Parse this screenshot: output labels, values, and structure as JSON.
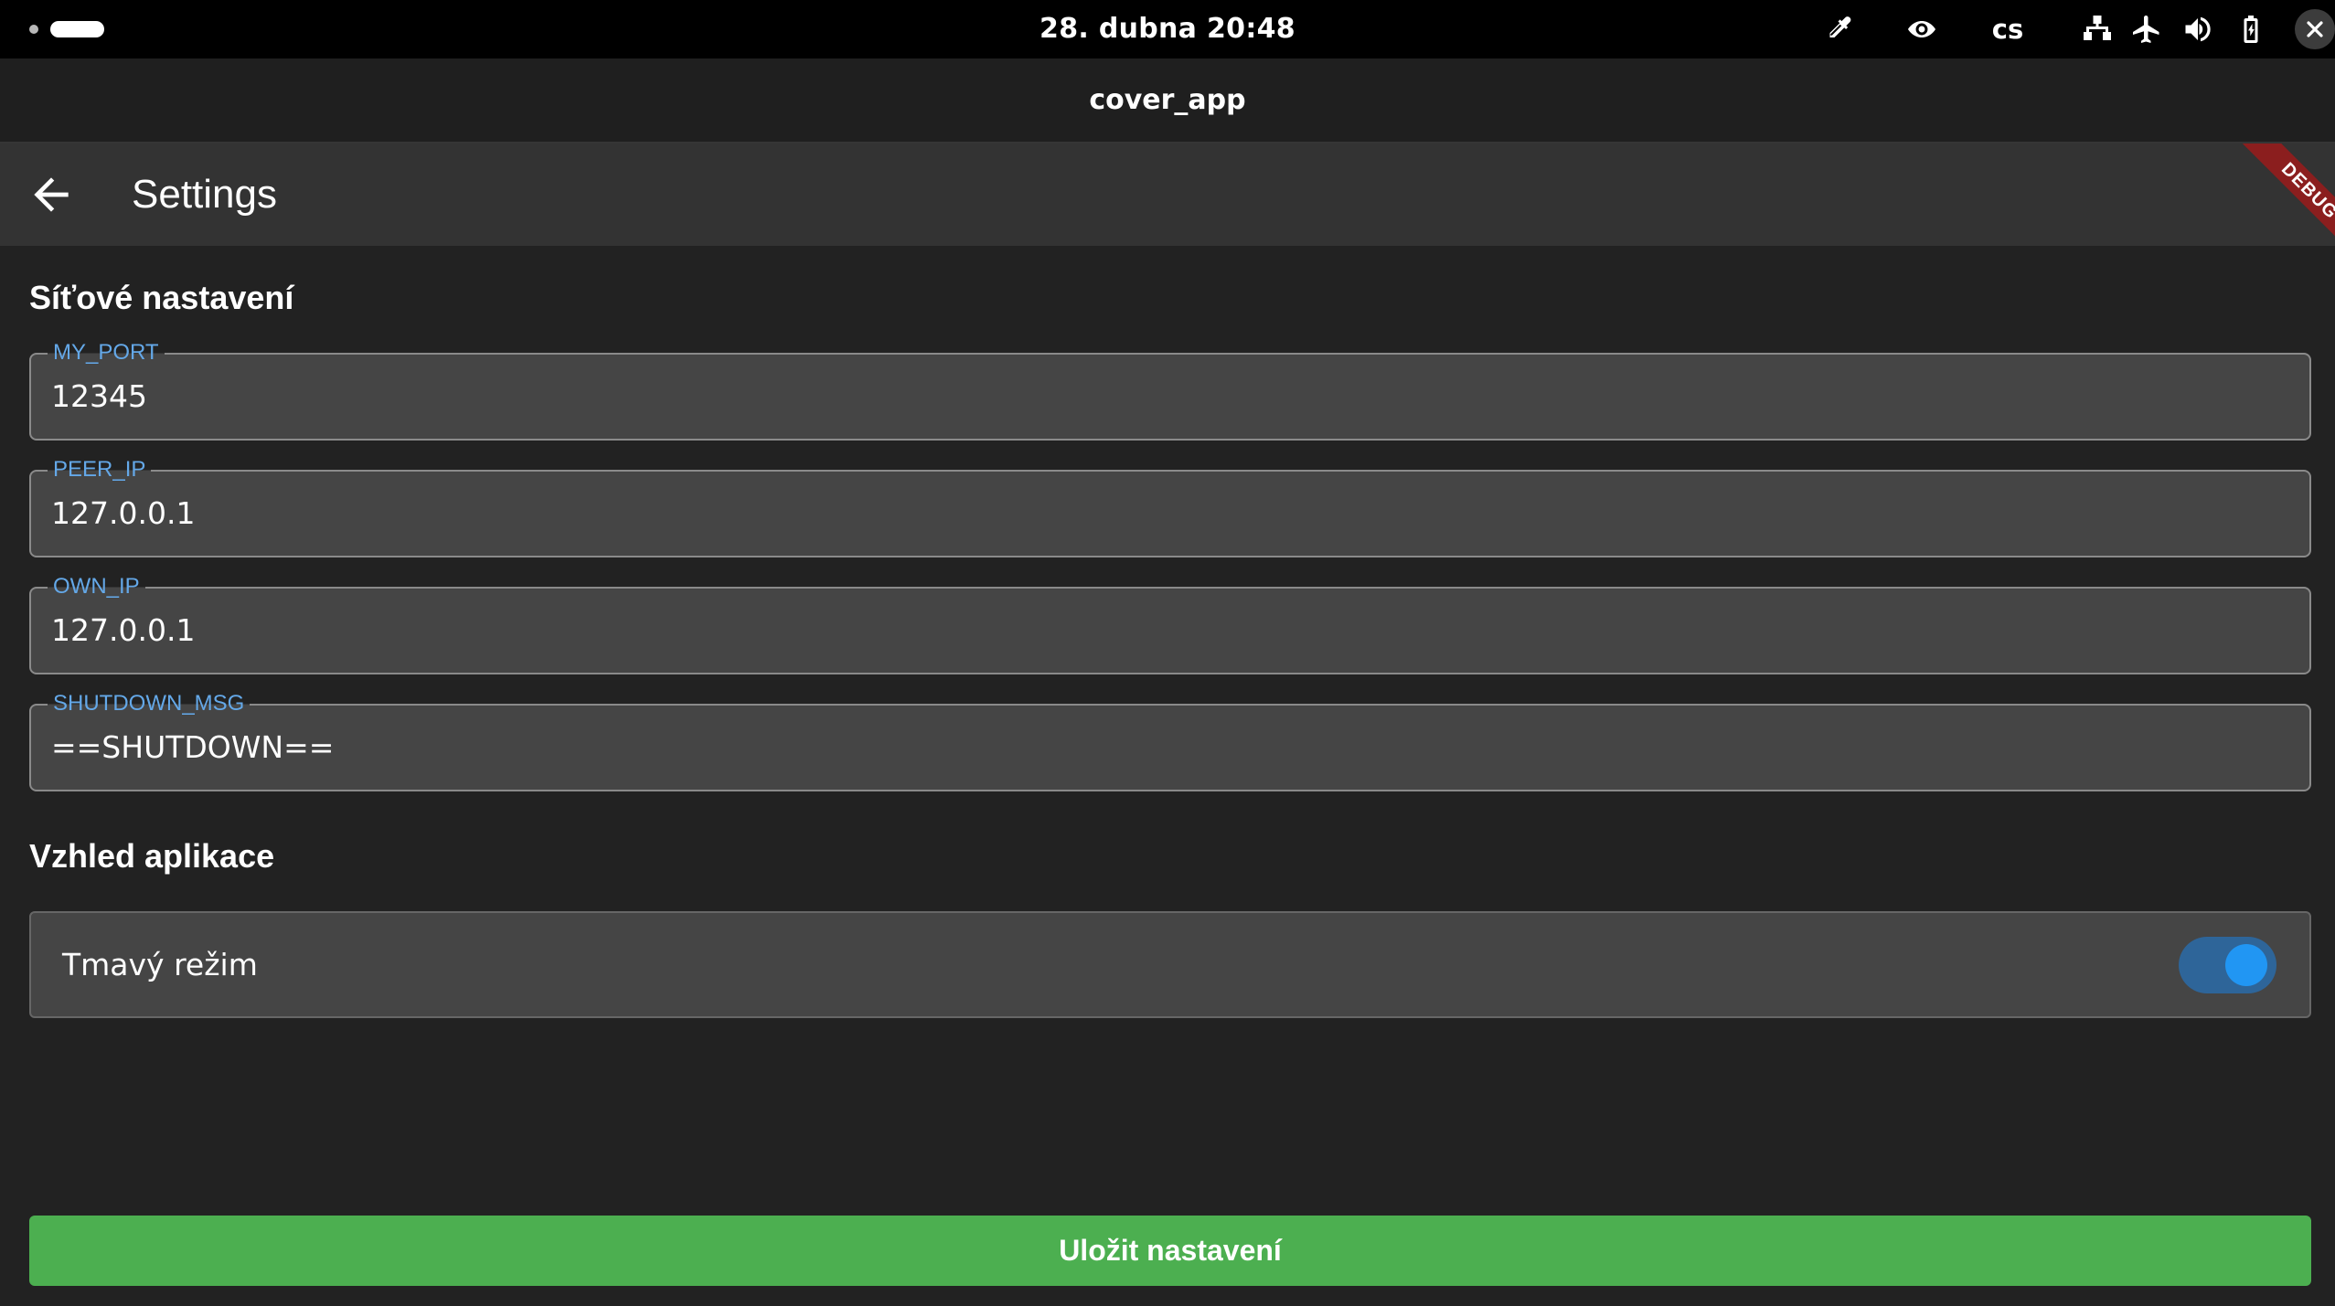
{
  "system_bar": {
    "datetime": "28. dubna  20:48",
    "language": "cs",
    "icons": [
      "color-picker-icon",
      "eye-icon",
      "network-icon",
      "airplane-icon",
      "volume-icon",
      "battery-icon",
      "close-icon"
    ]
  },
  "window": {
    "title": "cover_app"
  },
  "appbar": {
    "title": "Settings",
    "debug_banner": "DEBUG"
  },
  "network_section": {
    "title": "Síťové nastavení",
    "fields": [
      {
        "label": "MY_PORT",
        "value": "12345"
      },
      {
        "label": "PEER_IP",
        "value": "127.0.0.1"
      },
      {
        "label": "OWN_IP",
        "value": "127.0.0.1"
      },
      {
        "label": "SHUTDOWN_MSG",
        "value": "==SHUTDOWN=="
      }
    ]
  },
  "appearance_section": {
    "title": "Vzhled aplikace",
    "dark_mode_label": "Tmavý režim",
    "dark_mode_enabled": true
  },
  "save_button": {
    "label": "Uložit nastavení"
  },
  "colors": {
    "accent": "#2196f3",
    "field_label": "#64a8e8",
    "save_button": "#4caf50",
    "debug_banner": "#8b1e1e"
  }
}
